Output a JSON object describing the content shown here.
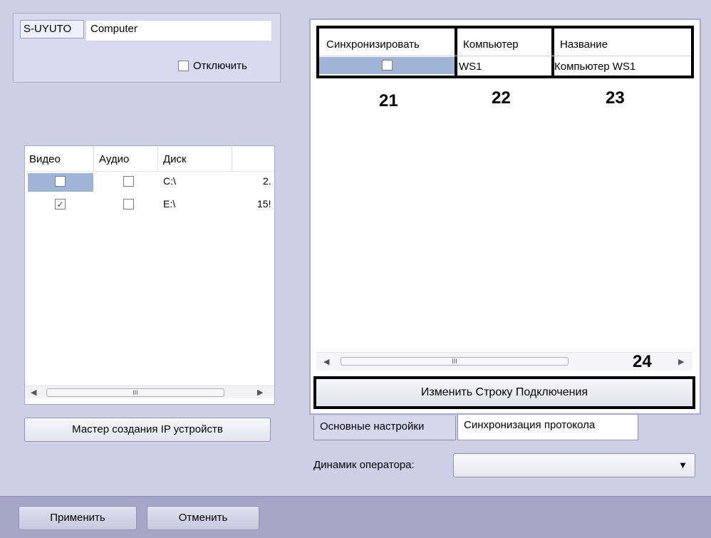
{
  "server": {
    "id": "S-UYUTO",
    "name": "Computer",
    "disable_label": "Отключить"
  },
  "disk_table": {
    "columns": [
      "Видео",
      "Аудио",
      "Диск",
      ""
    ],
    "rows": [
      {
        "video": false,
        "audio": false,
        "disk": "C:\\",
        "size": "2."
      },
      {
        "video": true,
        "audio": false,
        "disk": "E:\\",
        "size": "15!"
      }
    ]
  },
  "scrollbar_thumb_glyph": "III",
  "ip_wizard_button": "Мастер создания IP устройств",
  "sync_grid": {
    "columns": [
      "Синхронизировать",
      "Компьютер",
      "Название"
    ],
    "rows": [
      {
        "sync": false,
        "computer": "WS1",
        "name": "Компьютер WS1"
      }
    ]
  },
  "annotations": [
    "21",
    "22",
    "23",
    "24"
  ],
  "change_connection_button": "Изменить Строку Подключения",
  "tabs": {
    "basic": "Основные настройки",
    "sync": "Синхронизация протокола"
  },
  "speaker": {
    "label": "Динамик оператора:",
    "value": ""
  },
  "footer": {
    "apply": "Применить",
    "cancel": "Отменить"
  },
  "colors": {
    "background": "#cccfe6",
    "selection": "#9fb4d6",
    "bottom_bar": "#a4a7c7"
  }
}
